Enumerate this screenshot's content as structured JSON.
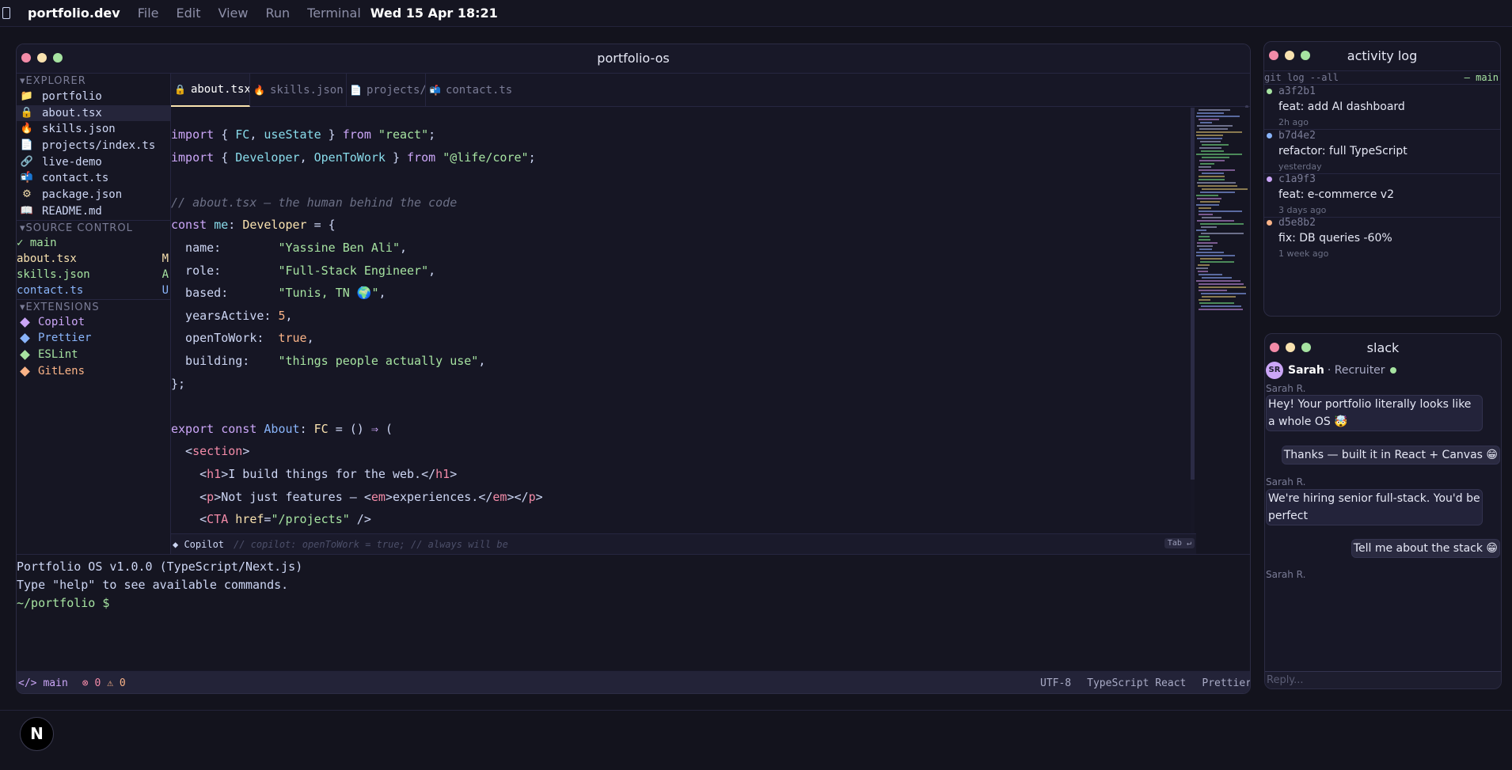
{
  "menubar": {
    "app_name": "portfolio.dev",
    "menus": [
      "File",
      "Edit",
      "View",
      "Run",
      "Terminal"
    ],
    "clock": "Wed 15 Apr 18:21"
  },
  "ide": {
    "title": "portfolio-os",
    "explorer": {
      "heading": "▾EXPLORER",
      "items": [
        {
          "icon": "folder-icon",
          "glyph": "📁",
          "label": "portfolio"
        },
        {
          "icon": "lock-icon",
          "glyph": "🔒",
          "label": "about.tsx",
          "active": true
        },
        {
          "icon": "flame-icon",
          "glyph": "🔥",
          "label": "skills.json"
        },
        {
          "icon": "file-icon",
          "glyph": "📄",
          "label": "projects/index.ts"
        },
        {
          "icon": "link-icon",
          "glyph": "🔗",
          "label": "live-demo"
        },
        {
          "icon": "mailbox-icon",
          "glyph": "📬",
          "label": "contact.ts"
        },
        {
          "icon": "gear-icon",
          "glyph": "⚙",
          "label": "package.json"
        },
        {
          "icon": "book-icon",
          "glyph": "📖",
          "label": "README.md"
        }
      ]
    },
    "source_control": {
      "heading": "▾SOURCE CONTROL",
      "branch": "✓ main",
      "changes": [
        {
          "file": "about.tsx",
          "status": "M",
          "color": "#f9e2af"
        },
        {
          "file": "skills.json",
          "status": "A",
          "color": "#a6e3a1"
        },
        {
          "file": "contact.ts",
          "status": "U",
          "color": "#89b4fa"
        }
      ]
    },
    "extensions": {
      "heading": "▾EXTENSIONS",
      "items": [
        {
          "label": "Copilot",
          "color": "#cba6f7"
        },
        {
          "label": "Prettier",
          "color": "#89b4fa"
        },
        {
          "label": "ESLint",
          "color": "#a6e3a1"
        },
        {
          "label": "GitLens",
          "color": "#fab387"
        }
      ]
    },
    "tabs": [
      {
        "label": "about.tsx",
        "glyph": "🔒",
        "icon": "lock-icon",
        "active": true
      },
      {
        "label": "skills.json",
        "glyph": "🔥",
        "icon": "flame-icon"
      },
      {
        "label": "projects/",
        "glyph": "📄",
        "icon": "file-icon"
      },
      {
        "label": "contact.ts",
        "glyph": "📬",
        "icon": "mailbox-icon"
      }
    ],
    "code": {
      "import_react": "\"react\"",
      "import_core": "\"@life/core\"",
      "comment": "// about.tsx — the human behind the code",
      "name": "\"Yassine Ben Ali\"",
      "role": "\"Full-Stack Engineer\"",
      "based": "\"Tunis, TN 🌍\"",
      "years_active": "5",
      "open_to_work": "true",
      "building": "\"things people actually use\"",
      "h1_text": "I build things for the web.",
      "p_text": "Not just features — ",
      "em_text": "experiences.",
      "cta_href": "\"/projects\""
    },
    "copilot": {
      "label": "◆ Copilot",
      "hint": "// copilot: openToWork = true; // always will be",
      "key": "Tab ↵"
    },
    "terminal": {
      "line1": "Portfolio OS v1.0.0 (TypeScript/Next.js)",
      "line2": "Type \"help\" to see available commands.",
      "prompt": "~/portfolio $"
    },
    "statusbar": {
      "branch_icon": "</>",
      "branch": "main",
      "errors": "⊗ 0",
      "warnings": "⚠ 0",
      "encoding": "UTF-8",
      "language": "TypeScript React",
      "formatter": "Prettier"
    }
  },
  "activity_log": {
    "title": "activity log",
    "command": "git log --all",
    "branch": "— main",
    "commits": [
      {
        "hash": "a3f2b1",
        "message": "feat: add AI dashboard",
        "ago": "2h ago",
        "color": "#a6e3a1"
      },
      {
        "hash": "b7d4e2",
        "message": "refactor: full TypeScript",
        "ago": "yesterday",
        "color": "#89b4fa"
      },
      {
        "hash": "c1a9f3",
        "message": "feat: e-commerce v2",
        "ago": "3 days ago",
        "color": "#cba6f7"
      },
      {
        "hash": "d5e8b2",
        "message": "fix: DB queries -60%",
        "ago": "1 week ago",
        "color": "#fab387"
      }
    ]
  },
  "slack": {
    "title": "slack",
    "avatar": "SR",
    "contact": "Sarah",
    "role": "· Recruiter",
    "messages": [
      {
        "sender": "Sarah R.",
        "text": "Hey! Your portfolio literally looks like a whole OS 🤯"
      },
      {
        "text": "Thanks — built it in React + Canvas 😁"
      },
      {
        "sender": "Sarah R.",
        "text": "We're hiring senior full-stack. You'd be perfect"
      },
      {
        "text": "Tell me about the stack 😁"
      },
      {
        "sender": "Sarah R."
      }
    ],
    "reply_placeholder": "Reply..."
  },
  "dock": {
    "launcher": "N"
  }
}
